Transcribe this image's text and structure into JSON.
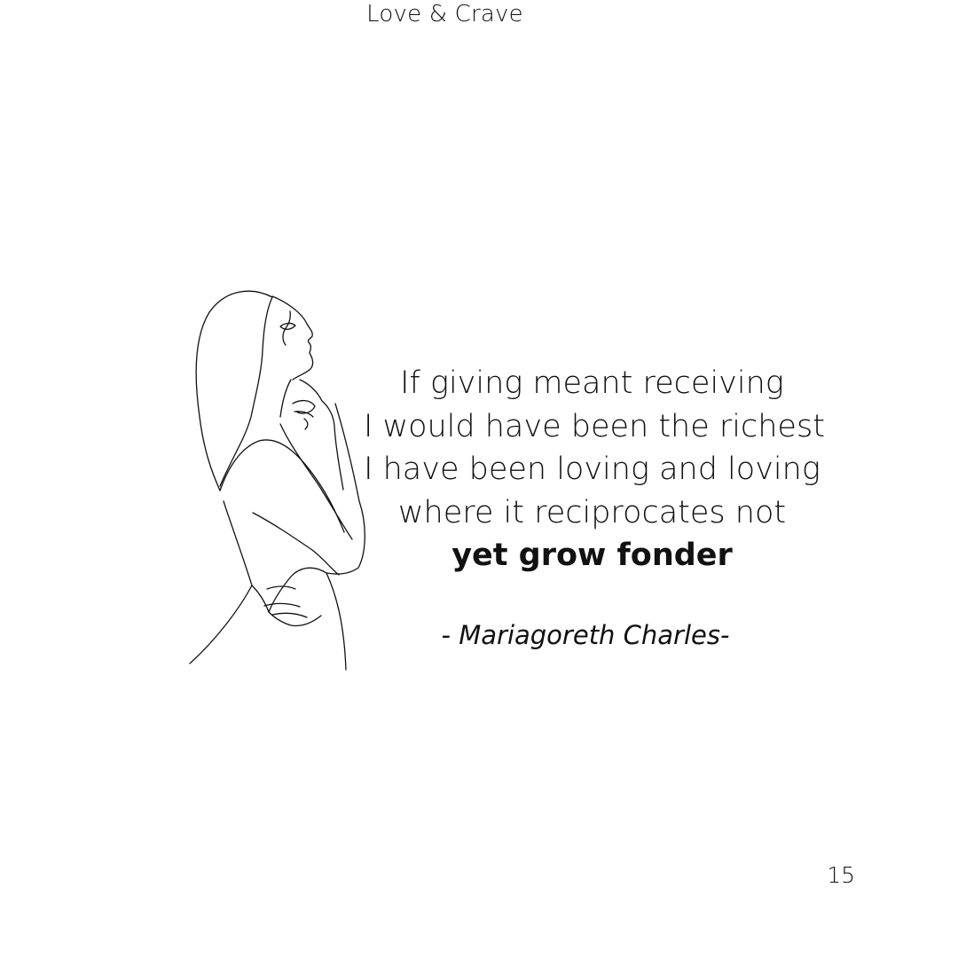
{
  "header": {
    "title": "Love & Crave"
  },
  "illustration": {
    "icon": "woman-line-art-illustration"
  },
  "poem": {
    "lines": [
      "If giving meant receiving",
      "I would have been the richest",
      "I have been loving and loving",
      "where it reciprocates not"
    ],
    "emphasis_line": "yet grow fonder",
    "attribution": "- Mariagoreth Charles-"
  },
  "footer": {
    "page_number": "15"
  }
}
